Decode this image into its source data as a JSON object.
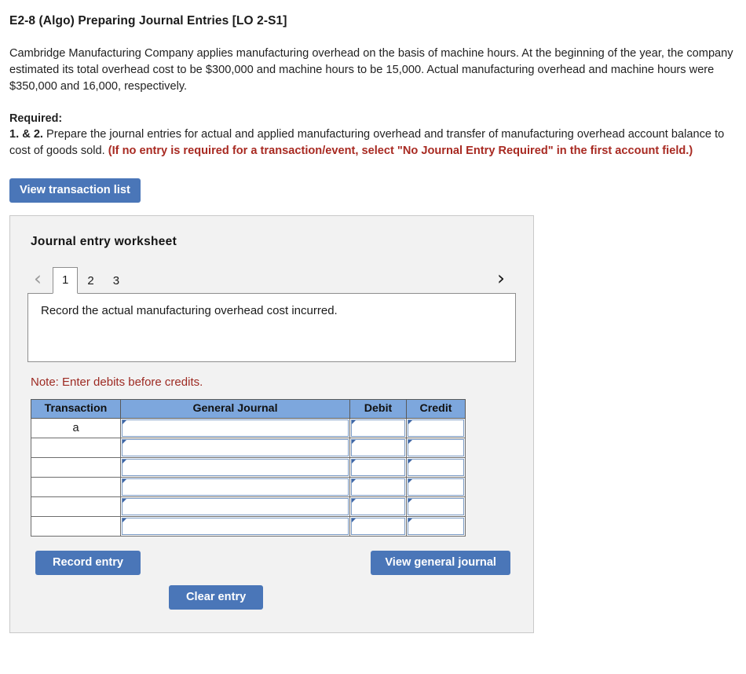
{
  "question": {
    "title": "E2-8 (Algo) Preparing Journal Entries [LO 2-S1]",
    "intro": "Cambridge Manufacturing Company applies manufacturing overhead on the basis of machine hours. At the beginning of the year, the company estimated its total overhead cost to be $300,000 and machine hours to be 15,000. Actual manufacturing overhead and machine hours were $350,000 and 16,000, respectively.",
    "required_label": "Required:",
    "required_number": "1. & 2.",
    "required_text": " Prepare the journal entries for actual and applied manufacturing overhead and transfer of manufacturing overhead account balance to cost of goods sold. ",
    "required_warning": "(If no entry is required for a transaction/event, select \"No Journal Entry Required\" in the first account field.)"
  },
  "buttons": {
    "view_transaction_list": "View transaction list",
    "record_entry": "Record entry",
    "clear_entry": "Clear entry",
    "view_general_journal": "View general journal"
  },
  "worksheet": {
    "title": "Journal entry worksheet",
    "prev_icon": "‹",
    "next_icon": "›",
    "tabs": [
      {
        "label": "1",
        "active": true
      },
      {
        "label": "2",
        "active": false
      },
      {
        "label": "3",
        "active": false
      }
    ],
    "description": "Record the actual manufacturing overhead cost incurred.",
    "note": "Note: Enter debits before credits."
  },
  "journal_table": {
    "headers": [
      "Transaction",
      "General Journal",
      "Debit",
      "Credit"
    ],
    "rows": [
      {
        "transaction": "a",
        "general_journal": "",
        "debit": "",
        "credit": ""
      },
      {
        "transaction": "",
        "general_journal": "",
        "debit": "",
        "credit": ""
      },
      {
        "transaction": "",
        "general_journal": "",
        "debit": "",
        "credit": ""
      },
      {
        "transaction": "",
        "general_journal": "",
        "debit": "",
        "credit": ""
      },
      {
        "transaction": "",
        "general_journal": "",
        "debit": "",
        "credit": ""
      },
      {
        "transaction": "",
        "general_journal": "",
        "debit": "",
        "credit": ""
      }
    ]
  },
  "colors": {
    "button_blue": "#4a76b8",
    "table_header_blue": "#7da7dd",
    "warning_red": "#a82a22",
    "note_red": "#9d2a22",
    "panel_gray": "#f2f2f2"
  }
}
